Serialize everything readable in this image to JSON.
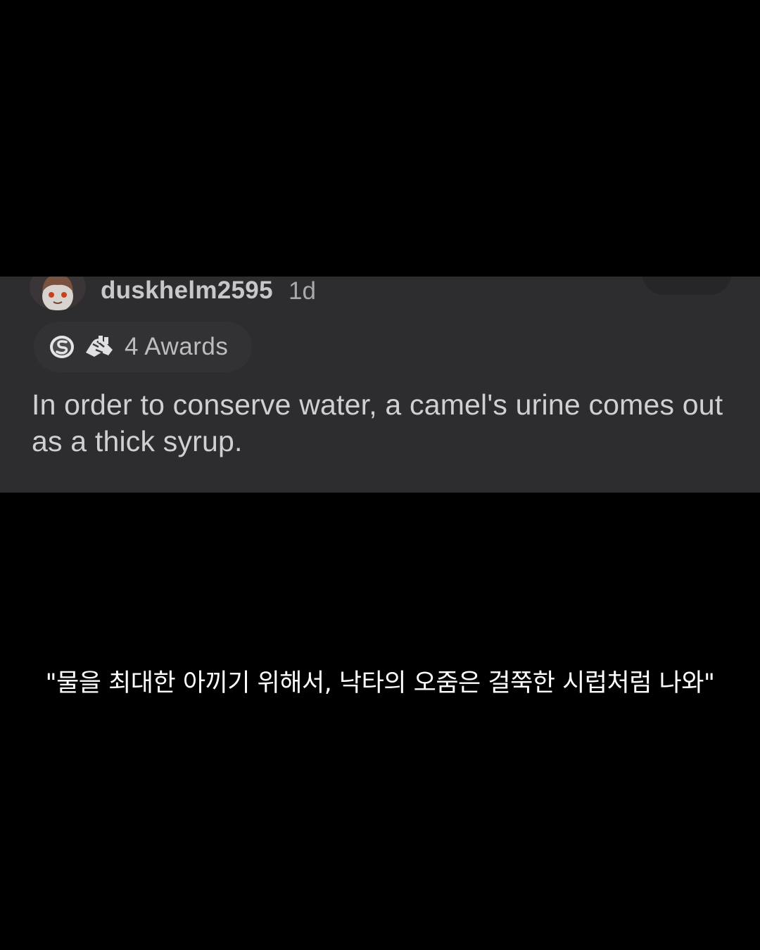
{
  "comment": {
    "avatar_icon": "snoo-avatar-icon",
    "username": "duskhelm2595",
    "timestamp": "1d",
    "awards": {
      "icons": [
        "silver-award-icon",
        "handshake-award-icon"
      ],
      "label": "4 Awards"
    },
    "body": "In order to conserve water, a camel's urine comes out as a thick syrup."
  },
  "subtitle": "\"물을 최대한 아끼기 위해서, 낙타의 오줌은 걸쭉한 시럽처럼 나와\"",
  "colors": {
    "page_background": "#000000",
    "card_background": "#2d2d2f",
    "primary_text": "#d0d0d2",
    "secondary_text": "#a9a9ab",
    "subtitle_text": "#ffffff"
  }
}
